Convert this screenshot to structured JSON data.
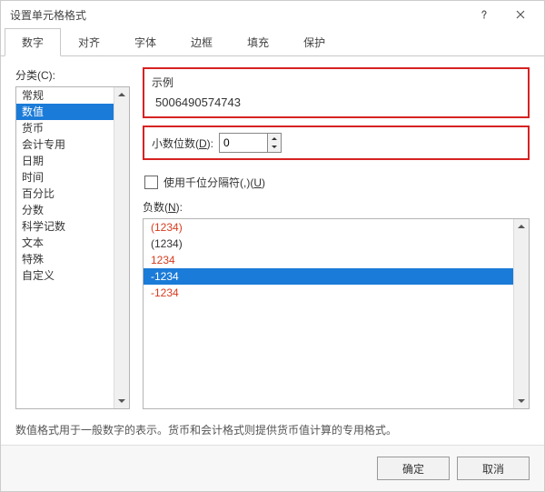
{
  "window": {
    "title": "设置单元格格式"
  },
  "tabs": [
    "数字",
    "对齐",
    "字体",
    "边框",
    "填充",
    "保护"
  ],
  "active_tab_index": 0,
  "category_label": "分类(C):",
  "categories": [
    "常规",
    "数值",
    "货币",
    "会计专用",
    "日期",
    "时间",
    "百分比",
    "分数",
    "科学记数",
    "文本",
    "特殊",
    "自定义"
  ],
  "selected_category_index": 1,
  "sample": {
    "label": "示例",
    "value": "5006490574743"
  },
  "decimal": {
    "label_prefix": "小数位数(",
    "mnemonic": "D",
    "label_suffix": "):",
    "value": "0"
  },
  "thousands": {
    "label_prefix": "使用千位分隔符(,)(",
    "mnemonic": "U",
    "label_suffix": ")",
    "checked": false
  },
  "negatives": {
    "label_prefix": "负数(",
    "mnemonic": "N",
    "label_suffix": "):",
    "items": [
      {
        "text": "(1234)",
        "color": "#d83b1e"
      },
      {
        "text": "(1234)",
        "color": "#333333"
      },
      {
        "text": "1234",
        "color": "#d83b1e"
      },
      {
        "text": "-1234",
        "color": "#ffffff",
        "bg": "#1b7bd8",
        "selected": true
      },
      {
        "text": "-1234",
        "color": "#d83b1e"
      }
    ]
  },
  "description": "数值格式用于一般数字的表示。货币和会计格式则提供货币值计算的专用格式。",
  "buttons": {
    "ok": "确定",
    "cancel": "取消"
  }
}
